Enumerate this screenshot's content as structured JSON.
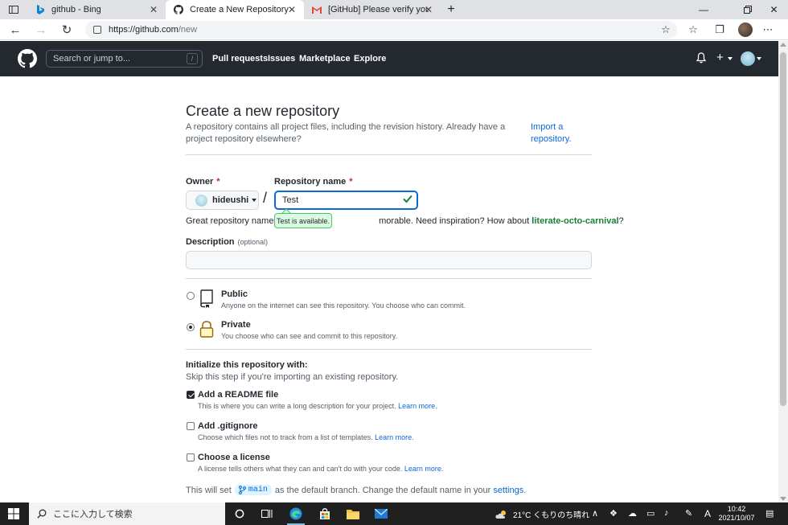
{
  "browser": {
    "tabs": [
      {
        "label": "github - Bing",
        "icon": "bing-icon"
      },
      {
        "label": "Create a New Repository",
        "icon": "github-icon"
      },
      {
        "label": "[GitHub] Please verify your device",
        "icon": "gmail-icon"
      }
    ],
    "url": {
      "host": "https://github.com",
      "path": "/new"
    }
  },
  "gh_header": {
    "search_placeholder": "Search or jump to...",
    "search_key": "/",
    "nav": [
      "Pull requests",
      "Issues",
      "Marketplace",
      "Explore"
    ]
  },
  "form": {
    "title": "Create a new repository",
    "subtitle": "A repository contains all project files, including the revision history. Already have a project repository elsewhere?",
    "import_link": "Import a repository.",
    "owner_label": "Owner",
    "owner_value": "hideushi",
    "repo_label": "Repository name",
    "required_mark": "*",
    "repo_value": "Test",
    "slash": "/",
    "available_tooltip": "Test is available.",
    "hint_before": "Great repository names a",
    "hint_after": "morable. Need inspiration? How about",
    "hint_suggestion": "literate-octo-carnival",
    "hint_end": "?",
    "description_label": "Description",
    "description_optional": "(optional)",
    "description_value": "",
    "visibility": [
      {
        "title": "Public",
        "desc": "Anyone on the internet can see this repository. You choose who can commit.",
        "checked": false,
        "icon": "repo-book-icon"
      },
      {
        "title": "Private",
        "desc": "You choose who can see and commit to this repository.",
        "checked": true,
        "icon": "lock-icon"
      }
    ],
    "init_title": "Initialize this repository with:",
    "init_sub": "Skip this step if you're importing an existing repository.",
    "init_options": [
      {
        "title": "Add a README file",
        "desc": "This is where you can write a long description for your project.",
        "link": "Learn more.",
        "checked": true
      },
      {
        "title": "Add .gitignore",
        "desc": "Choose which files not to track from a list of templates.",
        "link": "Learn more.",
        "checked": false
      },
      {
        "title": "Choose a license",
        "desc": "A license tells others what they can and can't do with your code.",
        "link": "Learn more.",
        "checked": false
      }
    ],
    "branch_before": "This will set",
    "branch_name": "main",
    "branch_after": "as the default branch. Change the default name in your",
    "branch_link": "settings",
    "branch_end": "."
  },
  "taskbar": {
    "search_placeholder": "ここに入力して検索",
    "weather": "21°C  くもりのち晴れ",
    "time": "10:42",
    "date": "2021/10/07",
    "ime": "A"
  },
  "colors": {
    "header_bg": "#24292f",
    "accent_blue": "#0969da",
    "success_green": "#1a7f37",
    "required_red": "#cf222e"
  }
}
